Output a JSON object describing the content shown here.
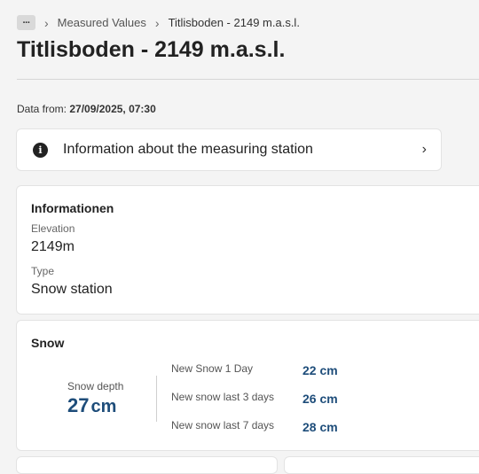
{
  "breadcrumb": {
    "more_label": "···",
    "items": [
      "Measured Values",
      "Titlisboden - 2149 m.a.s.l."
    ]
  },
  "page_title": "Titlisboden - 2149 m.a.s.l.",
  "data_from": {
    "label": "Data from:",
    "value": "27/09/2025, 07:30"
  },
  "station_info_link": "Information about the measuring station",
  "informationen": {
    "title": "Informationen",
    "elevation_label": "Elevation",
    "elevation_value": "2149m",
    "type_label": "Type",
    "type_value": "Snow station"
  },
  "snow": {
    "title": "Snow",
    "depth_label": "Snow depth",
    "depth_value": "27",
    "depth_unit": "cm",
    "new_snow": [
      {
        "label": "New Snow 1 Day",
        "value": "22",
        "unit": "cm"
      },
      {
        "label": "New snow last 3 days",
        "value": "26",
        "unit": "cm"
      },
      {
        "label": "New snow last 7 days",
        "value": "28",
        "unit": "cm"
      }
    ]
  }
}
